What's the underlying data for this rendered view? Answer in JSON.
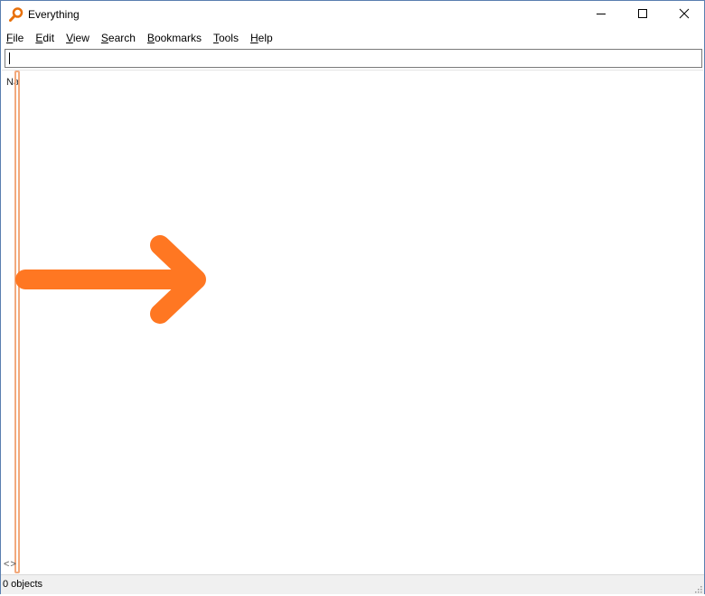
{
  "window": {
    "title": "Everything",
    "icon": "magnifier-icon",
    "controls": {
      "minimize": "minimize-icon",
      "maximize": "maximize-icon",
      "close": "close-icon"
    }
  },
  "menu": [
    {
      "u": "F",
      "rest": "ile"
    },
    {
      "u": "E",
      "rest": "dit"
    },
    {
      "u": "V",
      "rest": "iew"
    },
    {
      "u": "S",
      "rest": "earch"
    },
    {
      "u": "B",
      "rest": "ookmarks"
    },
    {
      "u": "T",
      "rest": "ools"
    },
    {
      "u": "H",
      "rest": "elp"
    }
  ],
  "search": {
    "value": ""
  },
  "results": {
    "column_header": "Na",
    "scroll_arrows": "<>"
  },
  "status": {
    "text": "0 objects"
  },
  "colors": {
    "annotation": "#ff7722",
    "highlight_border": "#f2a97c"
  }
}
